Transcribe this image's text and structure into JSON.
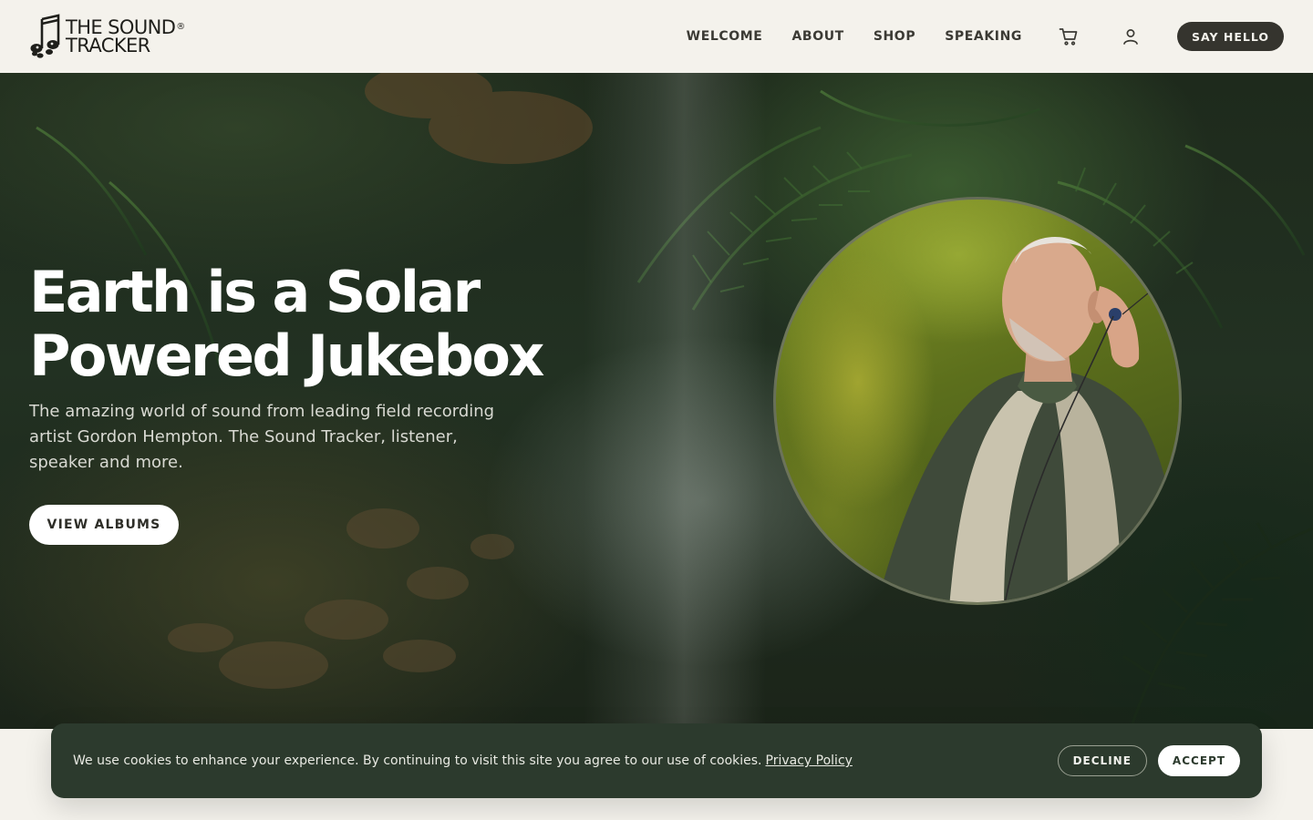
{
  "brand": {
    "line1": "THE SOUND",
    "line2": "TRACKER",
    "mark": "®"
  },
  "nav": {
    "links": [
      "WELCOME",
      "ABOUT",
      "SHOP",
      "SPEAKING"
    ],
    "cart_icon": "cart-icon",
    "account_icon": "user-icon",
    "cta": "SAY HELLO"
  },
  "hero": {
    "title_line1": "Earth is a Solar",
    "title_line2": "Powered Jukebox",
    "subtitle": "The amazing world of sound from leading field recording artist Gordon Hempton. The Sound Tracker, listener, speaker and more.",
    "button": "VIEW ALBUMS"
  },
  "cookie": {
    "text": "We use cookies to enhance your experience. By continuing to visit this site you agree to our use of cookies.",
    "link": "Privacy Policy",
    "decline": "DECLINE",
    "accept": "ACCEPT"
  },
  "colors": {
    "header_bg": "#f4f2ec",
    "cta_bg": "#35342e",
    "cookie_bg": "#2c3a2d",
    "hero_text": "#ffffff"
  }
}
